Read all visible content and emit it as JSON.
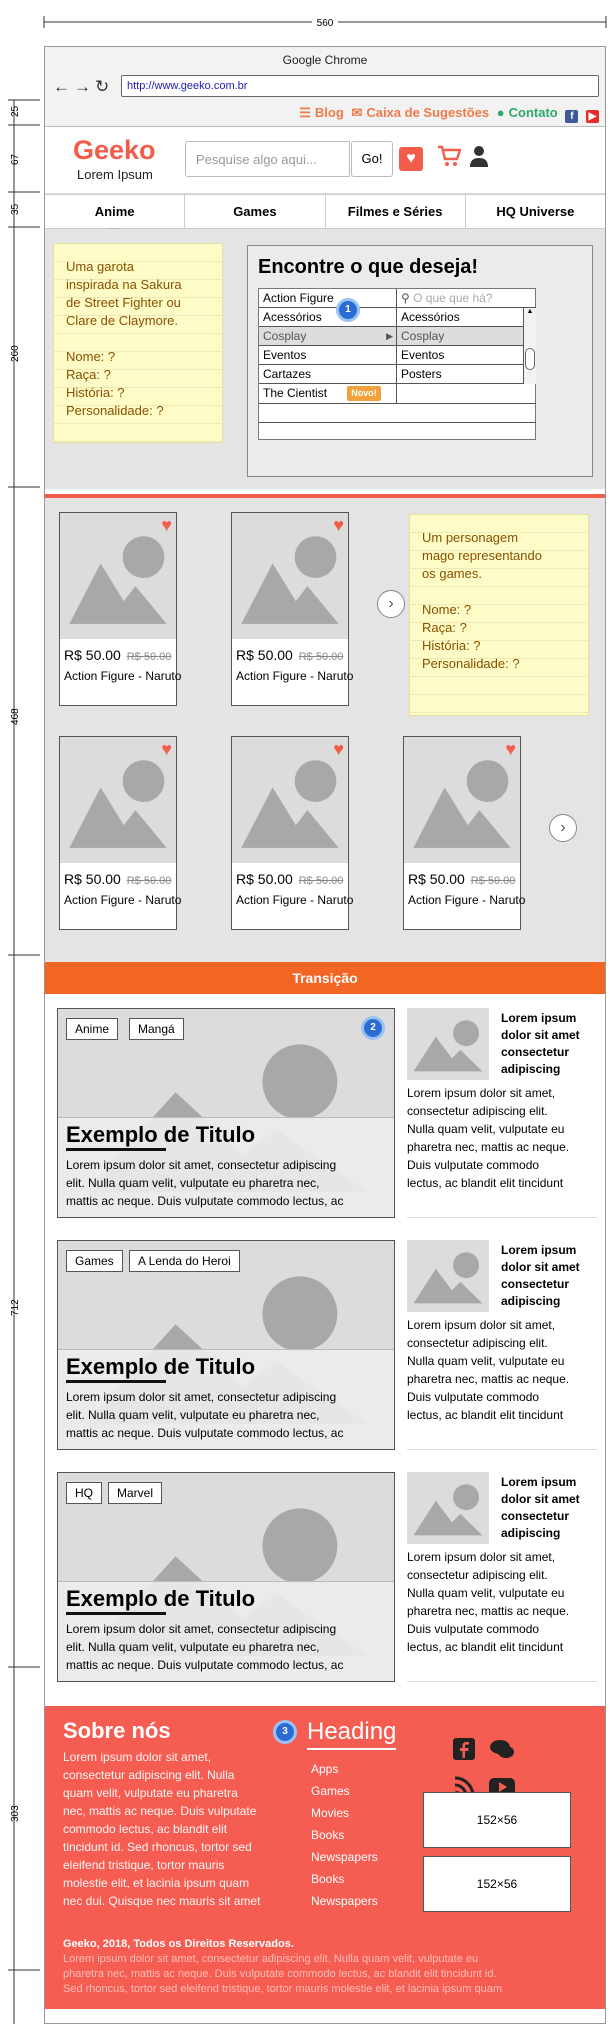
{
  "rulers": {
    "top": "560",
    "left": [
      "25",
      "67",
      "35",
      "260",
      "468",
      "712",
      "303"
    ]
  },
  "browser": {
    "title": "Google Chrome",
    "url": "http://www.geeko.com.br"
  },
  "topbar": {
    "blog": "Blog",
    "suggestions": "Caixa de Sugestões",
    "contact": "Contato",
    "facebook": "f",
    "youtube": "▶"
  },
  "header": {
    "logo": "Geeko",
    "tagline": "Lorem Ipsum",
    "search_placeholder": "Pesquise algo aqui...",
    "search_button": "Go!"
  },
  "tabs": [
    "Anime",
    "Games",
    "Filmes e Séries",
    "HQ Universe"
  ],
  "hero": {
    "note": [
      "Uma garota",
      "inspirada na Sakura",
      "de Street Fighter ou",
      "Clare de Claymore.",
      "",
      "Nome: ?",
      "Raça: ?",
      "História: ?",
      "Personalidade: ?"
    ],
    "finder_title": "Encontre o que deseja!",
    "search_placeholder": "O que que há?",
    "badge": "1",
    "menu_left": [
      "Action Figure",
      "Acessórios",
      "Cosplay",
      "Eventos",
      "Cartazes",
      "The Cientist"
    ],
    "menu_right": [
      "Acessórios",
      "Cosplay",
      "Eventos",
      "Posters"
    ],
    "new_badge": "Novo!"
  },
  "products": {
    "price": "R$ 50.00",
    "old_price": "R$ 50.00",
    "name": "Action Figure - Naruto",
    "note": [
      "Um personagem",
      "mago representando",
      "os games.",
      "",
      "Nome: ?",
      "Raça: ?",
      "História: ?",
      "Personalidade: ?"
    ]
  },
  "transition": "Transição",
  "articles": {
    "badge": "2",
    "items": [
      {
        "tags": [
          "Anime",
          "Mangá"
        ],
        "title": "Exemplo de Titulo"
      },
      {
        "tags": [
          "Games",
          "A Lenda do Heroi"
        ],
        "title": "Exemplo de Titulo"
      },
      {
        "tags": [
          "HQ",
          "Marvel"
        ],
        "title": "Exemplo de Titulo"
      }
    ],
    "text": [
      "Lorem ipsum dolor sit amet, consectetur adipiscing",
      "elit. Nulla quam velit, vulputate eu pharetra nec,",
      "mattis ac neque. Duis vulputate commodo lectus, ac"
    ],
    "side_heading": "Lorem ipsum dolor sit amet consectetur adipiscing",
    "side_text": [
      "Lorem ipsum dolor sit amet,",
      "consectetur adipiscing elit.",
      "Nulla quam velit, vulputate eu",
      "pharetra nec, mattis ac neque.",
      "Duis vulputate commodo",
      "lectus, ac blandit elit tincidunt"
    ]
  },
  "footer": {
    "about_title": "Sobre nós",
    "about_text": [
      "Lorem ipsum dolor sit amet,",
      "consectetur adipiscing elit. Nulla",
      "quam velit, vulputate eu pharetra",
      "nec, mattis ac neque. Duis vulputate",
      "commodo lectus, ac blandit elit",
      "tincidunt id. Sed rhoncus, tortor sed",
      "eleifend tristique, tortor mauris",
      "molestie elit, et lacinia ipsum quam",
      "nec dui. Quisque nec mauris sit amet"
    ],
    "badge": "3",
    "heading": "Heading",
    "links": [
      "Apps",
      "Games",
      "Movies",
      "Books",
      "Newspapers",
      "Books",
      "Newspapers"
    ],
    "placeholder1": "152×56",
    "placeholder2": "152×56",
    "copyright": "Geeko, 2018, Todos os Direitos Reservados.",
    "fine": [
      "Lorem ipsum dolor sit amet, consectetur adipiscing elit. Nulla quam velit, vulputate eu",
      "pharetra nec, mattis ac neque. Duis vulputate commodo lectus, ac blandit elit tincidunt id.",
      "Sed rhoncus, tortor sed eleifend tristique, tortor mauris molestie elit, et lacinia ipsum quam"
    ]
  }
}
